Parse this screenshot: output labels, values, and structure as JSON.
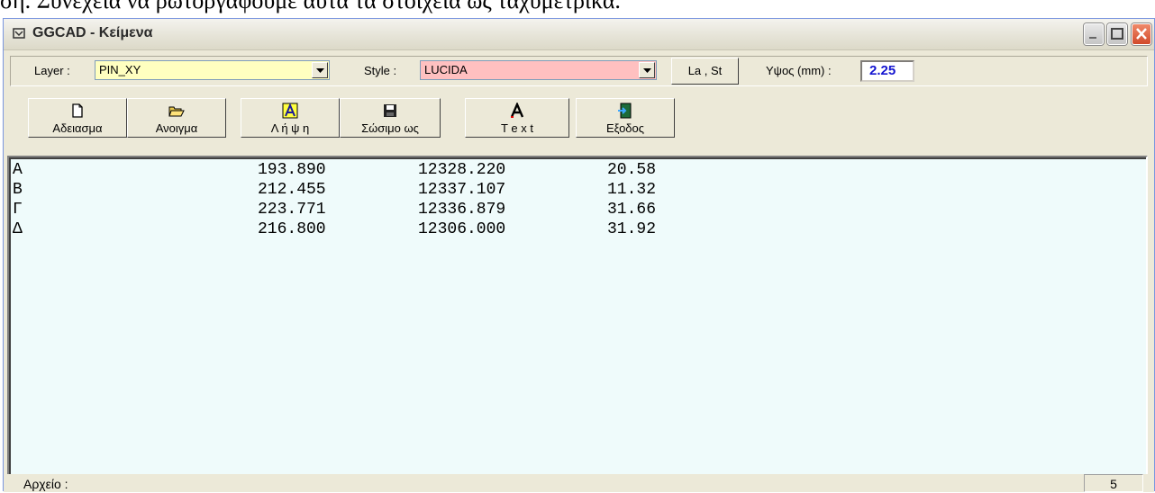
{
  "document_text": "ση. Συνέχεια να ρωτοργάφουμε αυτά τα στοιχεία ως ταχυμετρικά.",
  "window": {
    "title": "GGCAD - Κείμενα"
  },
  "settings": {
    "layer_label": "Layer :",
    "layer_value": "PIN_XY",
    "style_label": "Style :",
    "style_value": "LUCIDA",
    "la_st_button": "La , St",
    "height_label": "Υψος (mm) :",
    "height_value": "2.25"
  },
  "toolbar": [
    {
      "label": "Αδειασμα",
      "icon": "new-file-icon"
    },
    {
      "label": "Ανοιγμα",
      "icon": "open-folder-icon"
    },
    {
      "label": "Λ ή ψ η",
      "icon": "capture-text-icon"
    },
    {
      "label": "Σώσιμο ως",
      "icon": "save-icon"
    },
    {
      "label": "T e x t",
      "icon": "text-icon"
    },
    {
      "label": "Εξοδος",
      "icon": "exit-icon"
    }
  ],
  "text_rows": [
    [
      "Α",
      "193.890",
      "12328.220",
      "20.58"
    ],
    [
      "Β",
      "212.455",
      "12337.107",
      "11.32"
    ],
    [
      "Γ",
      "223.771",
      "12336.879",
      "31.66"
    ],
    [
      "Δ",
      "216.800",
      "12306.000",
      "31.92"
    ]
  ],
  "status": {
    "label": "Αρχείο :",
    "count": "5"
  },
  "colors": {
    "layer_bg": "#ffffc0",
    "style_bg": "#ffc0c0",
    "textarea_bg": "#effbfb",
    "height_value": "#1515d0"
  }
}
